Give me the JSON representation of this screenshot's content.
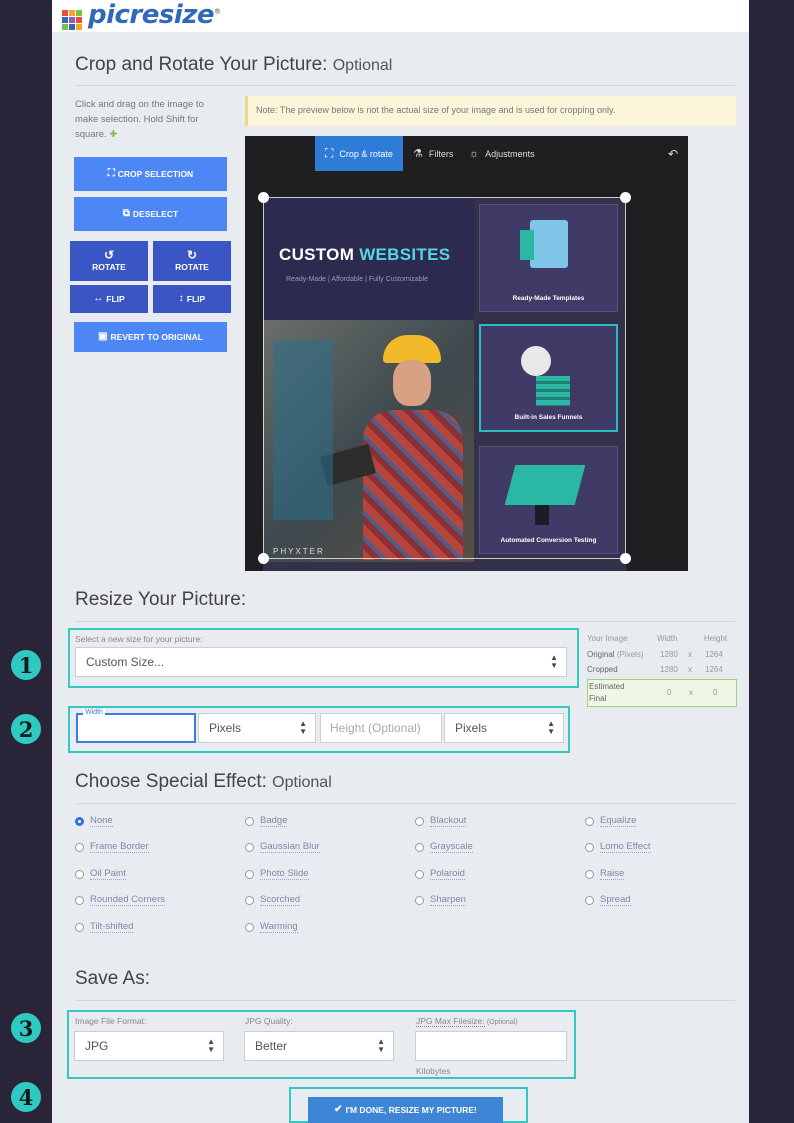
{
  "app": {
    "logo_text": "picresize",
    "logo_reg": "®"
  },
  "crop": {
    "title": "Crop and Rotate Your Picture:",
    "title_optional": "Optional",
    "hint": "Click and drag on the image to make selection. Hold Shift for square.",
    "note": "Note: The preview below is not the actual size of your image and is used for cropping only.",
    "crop_selection": "Crop Selection",
    "deselect": "Deselect",
    "rotate_left": "Rotate",
    "rotate_right": "Rotate",
    "flip_h": "Flip",
    "flip_v": "Flip",
    "revert": "Revert to Original"
  },
  "editor": {
    "tabs": [
      "Crop & rotate",
      "Filters",
      "Adjustments"
    ],
    "image": {
      "headline_a": "CUSTOM ",
      "headline_b": "WEBSITES",
      "subline": "Ready-Made | Affordable | Fully Customizable",
      "cards": [
        "Ready-Made Templates",
        "Built-in Sales Funnels",
        "Automated Conversion Testing"
      ],
      "watermark": "PHYXTER"
    }
  },
  "resize": {
    "title": "Resize Your Picture:",
    "select_label": "Select a new size for your picture:",
    "select_value": "Custom Size...",
    "width_label": "Width",
    "width_value": "",
    "width_unit": "Pixels",
    "height_placeholder": "Height (Optional)",
    "height_unit": "Pixels",
    "info": {
      "header_image": "Your Image",
      "header_width": "Width",
      "header_height": "Height",
      "original_label": "Original",
      "original_unit": "(Pixels)",
      "original_w": "1280",
      "original_h": "1264",
      "cropped_label": "Cropped",
      "cropped_w": "1280",
      "cropped_h": "1264",
      "estimated_label": "Estimated",
      "final_label": "Final",
      "final_w": "0",
      "final_h": "0",
      "x": "x"
    }
  },
  "effects": {
    "title": "Choose Special Effect:",
    "title_optional": "Optional",
    "items": [
      "None",
      "Badge",
      "Blackout",
      "Equalize",
      "Frame Border",
      "Gaussian Blur",
      "Grayscale",
      "Lomo Effect",
      "Oil Paint",
      "Photo Slide",
      "Polaroid",
      "Raise",
      "Rounded Corners",
      "Scorched",
      "Sharpen",
      "Spread",
      "Tilt-shifted",
      "Warming"
    ],
    "selected": "None"
  },
  "save": {
    "title": "Save As:",
    "format_label": "Image File Format:",
    "format_value": "JPG",
    "quality_label": "JPG Quality:",
    "quality_value": "Better",
    "maxsize_label": "JPG Max Filesize:",
    "maxsize_optional": "(Optional)",
    "maxsize_value": "",
    "maxsize_unit": "Kilobytes",
    "done_button": "I'm Done, Resize My Picture!"
  },
  "annotations": {
    "b1": "1",
    "b2": "2",
    "b3": "3",
    "b4": "4"
  },
  "colors": {
    "accent": "#4d86f5",
    "accent_dark": "#3a56c4",
    "highlight": "#34c8c2",
    "background": "#2a2438"
  }
}
